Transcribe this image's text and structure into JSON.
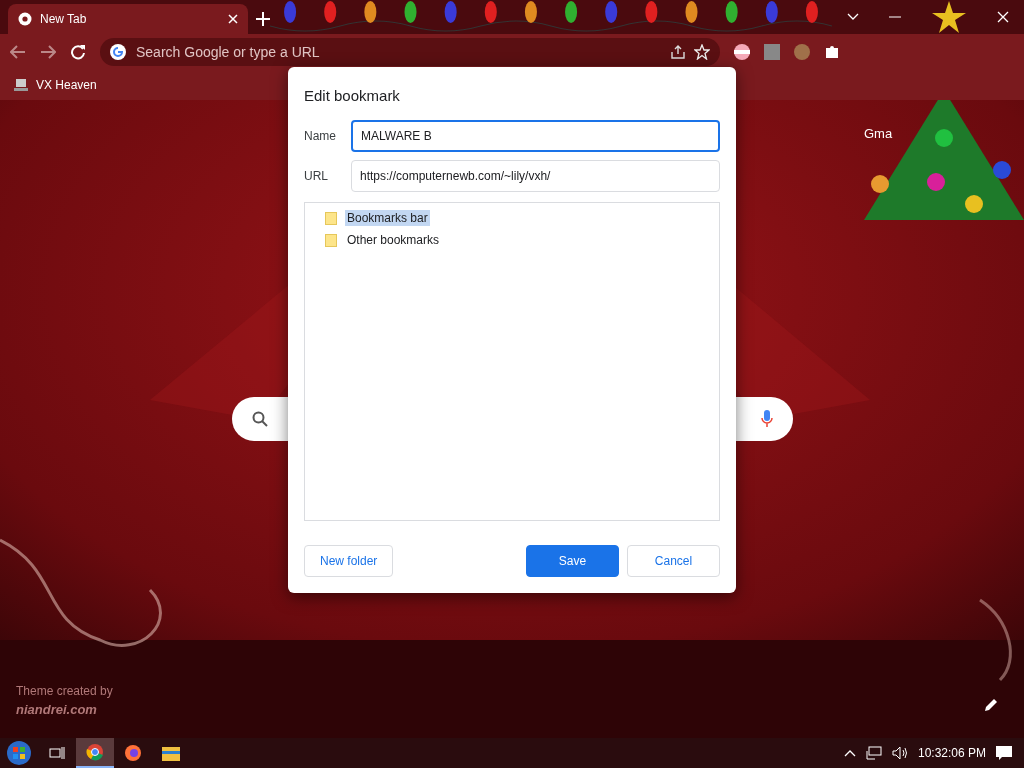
{
  "browser": {
    "tabs": [
      {
        "title": "New Tab",
        "selected": true
      }
    ],
    "address_bar": {
      "placeholder": "Search Google or type a URL"
    },
    "bookmarks": [
      {
        "label": "VX Heaven"
      }
    ]
  },
  "new_tab_page": {
    "shortcut_link": "Gma",
    "theme_credit": [
      "Theme created by",
      "niandrei.com"
    ]
  },
  "dialog": {
    "title": "Edit bookmark",
    "name_label": "Name",
    "name_value": "MALWARE B",
    "url_label": "URL",
    "url_value": "https://computernewb.com/~lily/vxh/",
    "folders": [
      {
        "label": "Bookmarks bar",
        "selected": true
      },
      {
        "label": "Other bookmarks",
        "selected": false
      }
    ],
    "buttons": {
      "new_folder": "New folder",
      "save": "Save",
      "cancel": "Cancel"
    }
  },
  "taskbar": {
    "clock": "10:32:06 PM"
  }
}
